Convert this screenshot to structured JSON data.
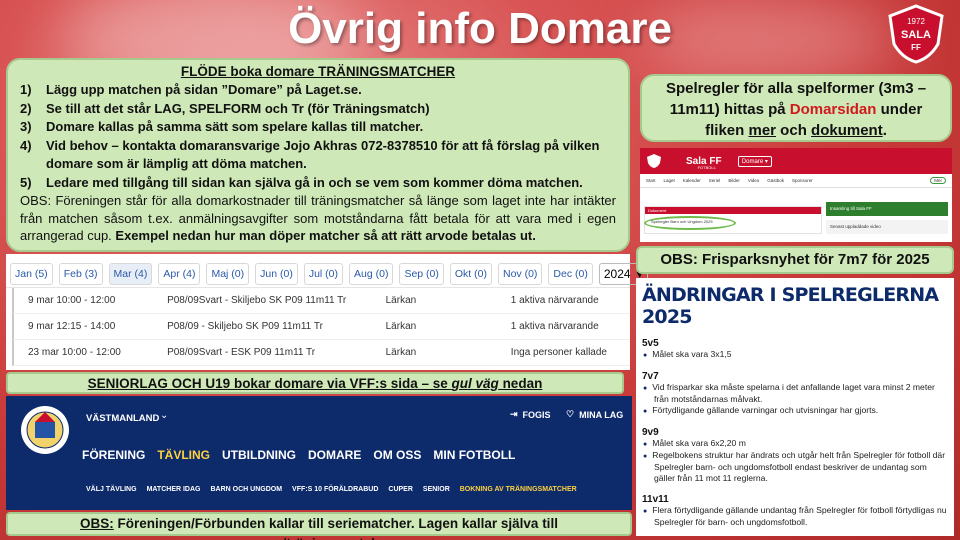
{
  "title": "Övrig info Domare",
  "logo": {
    "year": "1972",
    "letters": "SALA",
    "ff": "FF"
  },
  "flow": {
    "heading": "FLÖDE boka domare TRÄNINGSMATCHER",
    "steps": [
      {
        "num": "1)",
        "text": "Lägg upp matchen på sidan ”Domare” på Laget.se."
      },
      {
        "num": "2)",
        "text": "Se till att det står LAG, SPELFORM och Tr (för Träningsmatch)"
      },
      {
        "num": "3)",
        "text": "Domare kallas på samma sätt som spelare kallas till matcher."
      },
      {
        "num": "4)",
        "text": "Vid behov – kontakta domaransvarige Jojo Akhras 072-8378510 för att få förslag på vilken domare som är lämplig att döma matchen."
      },
      {
        "num": "5)",
        "text": "Ledare med tillgång till sidan kan själva gå in och se vem som kommer döma matchen."
      }
    ],
    "obs": "OBS: Föreningen står för alla domarkostnader till träningsmatcher så länge som laget inte har intäkter från matchen såsom t.ex. anmälningsavgifter som motståndarna fått betala för att vara med i egen arrangerad cup.",
    "obs_bold": "Exempel nedan hur man döper matcher så att rätt arvode betalas ut."
  },
  "calendar": {
    "months": [
      "Jan (5)",
      "Feb (3)",
      "Mar (4)",
      "Apr (4)",
      "Maj (0)",
      "Jun (0)",
      "Jul (0)",
      "Aug (0)",
      "Sep (0)",
      "Okt (0)",
      "Nov (0)",
      "Dec (0)"
    ],
    "active_month": "Mar (4)",
    "year": "2024",
    "rows": [
      {
        "time": "9 mar 10:00 - 12:00",
        "match": "P08/09Svart - Skiljebo SK P09 11m11 Tr",
        "place": "Lärkan",
        "status": "1 aktiva närvarande"
      },
      {
        "time": "9 mar 12:15 - 14:00",
        "match": "P08/09 - Skiljebo SK P09 11m11 Tr",
        "place": "Lärkan",
        "status": "1 aktiva närvarande"
      },
      {
        "time": "23 mar 10:00 - 12:00",
        "match": "P08/09Svart - ESK P09 11m11 Tr",
        "place": "Lärkan",
        "status": "Inga personer kallade"
      }
    ]
  },
  "senior": {
    "prefix": "SENIORLAG OCH U19 bokar domare via VFF:s sida – se ",
    "italic": "gul väg",
    "suffix": " nedan"
  },
  "vff": {
    "region": "VÄSTMANLAND",
    "fogis": "FOGIS",
    "mina_lag": "MINA LAG",
    "nav": [
      "FÖRENING",
      "TÄVLING",
      "UTBILDNING",
      "DOMARE",
      "OM OSS",
      "MIN FOTBOLL"
    ],
    "highlight_nav": "TÄVLING",
    "sub": [
      "VÄLJ TÄVLING",
      "MATCHER IDAG",
      "BARN OCH UNGDOM",
      "VFF:S 10 FÖRÄLDRABUD",
      "CUPER",
      "SENIOR",
      "BOKNING AV TRÄNINGSMATCHER"
    ],
    "highlight_sub": "BOKNING AV TRÄNINGSMATCHER"
  },
  "obs_bottom": {
    "prefix": "OBS:",
    "text": " Föreningen/Förbunden kallar till seriematcher. Lagen kallar själva till cuper/träningsmatcher"
  },
  "rules": {
    "text1": "Spelregler för alla spelformer (3m3 – 11m11) hittas på ",
    "link": "Domarsidan",
    "text2": " under fliken ",
    "mer": "mer",
    "och": " och ",
    "dok": "dokument",
    "end": "."
  },
  "sala": {
    "name": "Sala FF",
    "fotboll": "FOTBOLL",
    "dropdown": "Domare",
    "nav": [
      "Start",
      "Laget",
      "Kalender",
      "Seriel",
      "Bilder",
      "Video",
      "Gästbok",
      "Sponsorer"
    ],
    "mer": "Mer",
    "doc_title": "Dokument",
    "doc_file": "Spelregler Barn och Ungdom 2025",
    "insamling": "Insamling till Sala FF",
    "senast": "Senast uppladdade video"
  },
  "obs_free": "OBS: Frisparksnyhet för 7m7 för 2025",
  "changes": {
    "heading": "ÄNDRINGAR I SPELREGLERNA 2025",
    "sections": [
      {
        "title": "5v5",
        "items": [
          "Målet ska vara 3x1,5"
        ]
      },
      {
        "title": "7v7",
        "items": [
          "Vid frisparkar ska måste spelarna i det anfallande laget vara minst 2 meter från motståndarnas målvakt.",
          "Förtydligande gällande varningar och utvisningar har gjorts."
        ]
      },
      {
        "title": "9v9",
        "items": [
          "Målet ska vara 6x2,20 m",
          "Regelbokens struktur har ändrats och utgår helt från Spelregler för fotboll där Spelregler barn- och ungdomsfotboll endast beskriver de undantag som gäller från 11 mot 11 reglerna."
        ]
      },
      {
        "title": "11v11",
        "items": [
          "Flera förtydligande gällande undantag från Spelregler för fotboll förtydligas nu Spelregler för barn- och ungdomsfotboll."
        ]
      }
    ]
  }
}
